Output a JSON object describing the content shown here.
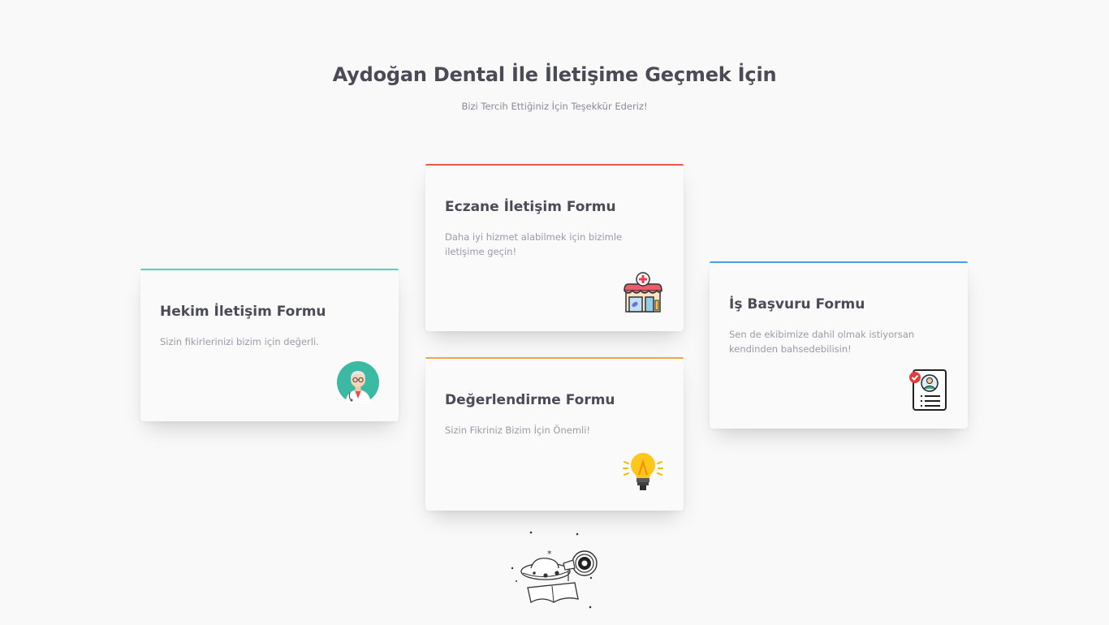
{
  "header": {
    "title": "Aydoğan Dental İle İletişime Geçmek İçin",
    "subtitle": "Bizi Tercih Ettiğiniz İçin Teşekkür Ederiz!"
  },
  "cards": [
    {
      "title": "Hekim İletişim Formu",
      "text": "Sizin fikirlerinizi bizim için değerli.",
      "accent": "#4fd1c5",
      "icon": "doctor-icon"
    },
    {
      "title": "Eczane İletişim Formu",
      "text": "Daha iyi hizmet alabilmek için bizimle iletişime geçin!",
      "accent": "#ea5a4b",
      "icon": "pharmacy-store-icon"
    },
    {
      "title": "Değerlendirme Formu",
      "text": "Sizin Fikriniz Bizim İçin Önemli!",
      "accent": "#f6a33c",
      "icon": "lightbulb-icon"
    },
    {
      "title": "İş Başvuru Formu",
      "text": "Sen de ekibimize dahil olmak istiyorsan kendinden bahsedebilisin!",
      "accent": "#4a9fe8",
      "icon": "resume-icon"
    }
  ],
  "footer_illustration": "ufo-telescope-illustration"
}
